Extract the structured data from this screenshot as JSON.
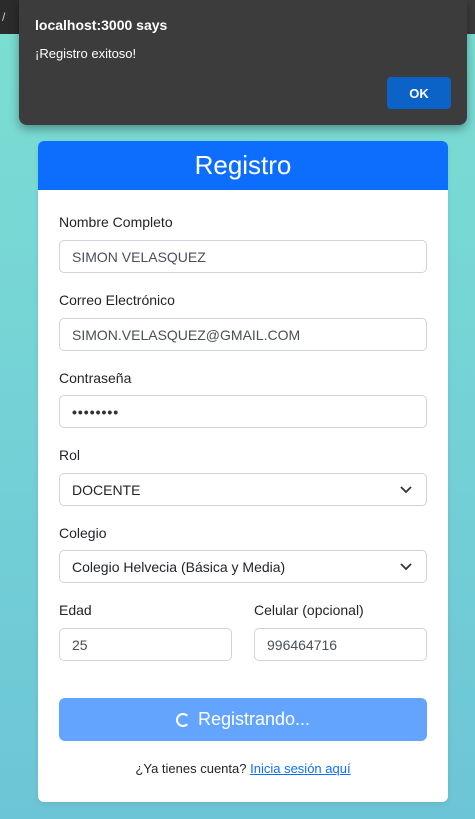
{
  "browser": {
    "fragment": "/"
  },
  "alert": {
    "title": "localhost:3000 says",
    "message": "¡Registro exitoso!",
    "ok_label": "OK"
  },
  "form": {
    "header": "Registro",
    "name": {
      "label": "Nombre Completo",
      "value": "SIMON VELASQUEZ"
    },
    "email": {
      "label": "Correo Electrónico",
      "value": "SIMON.VELASQUEZ@GMAIL.COM"
    },
    "password": {
      "label": "Contraseña",
      "masked": "••••••••"
    },
    "role": {
      "label": "Rol",
      "selected": "DOCENTE"
    },
    "school": {
      "label": "Colegio",
      "selected": "Colegio Helvecia (Básica y Media)"
    },
    "age": {
      "label": "Edad",
      "value": "25"
    },
    "phone": {
      "label": "Celular (opcional)",
      "value": "996464716"
    },
    "submit_label": "Registrando...",
    "footer_text": "¿Ya tienes cuenta?",
    "login_link": "Inicia sesión aquí"
  },
  "colors": {
    "primary": "#0d6efd",
    "button_disabled": "#63a4fe",
    "dialog_bg": "#3c3c3c"
  }
}
